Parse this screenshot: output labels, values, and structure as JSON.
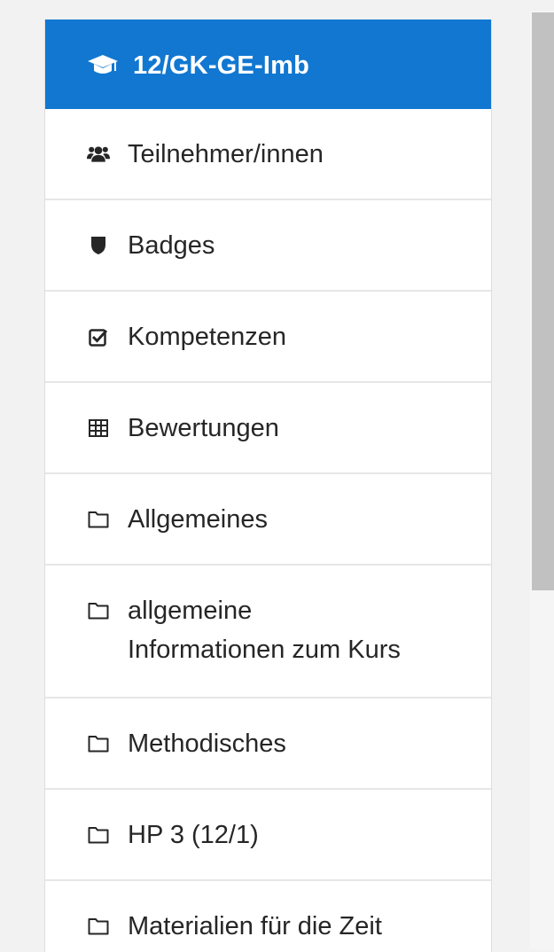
{
  "nav": {
    "course_title": "12/GK-GE-Imb",
    "items": [
      {
        "label": "Teilnehmer/innen",
        "icon": "users-icon"
      },
      {
        "label": "Badges",
        "icon": "shield-icon"
      },
      {
        "label": "Kompetenzen",
        "icon": "checkbox-icon"
      },
      {
        "label": "Bewertungen",
        "icon": "table-icon"
      },
      {
        "label": "Allgemeines",
        "icon": "folder-icon"
      },
      {
        "label_line1": "allgemeine",
        "label_line2": "Informationen zum Kurs",
        "icon": "folder-icon"
      },
      {
        "label": "Methodisches",
        "icon": "folder-icon"
      },
      {
        "label": "HP 3 (12/1)",
        "icon": "folder-icon"
      },
      {
        "label": "Materialien für die Zeit",
        "icon": "folder-icon"
      }
    ]
  },
  "colors": {
    "header_bg": "#1177d1",
    "background": "#f2f2f2",
    "text": "#262626"
  }
}
